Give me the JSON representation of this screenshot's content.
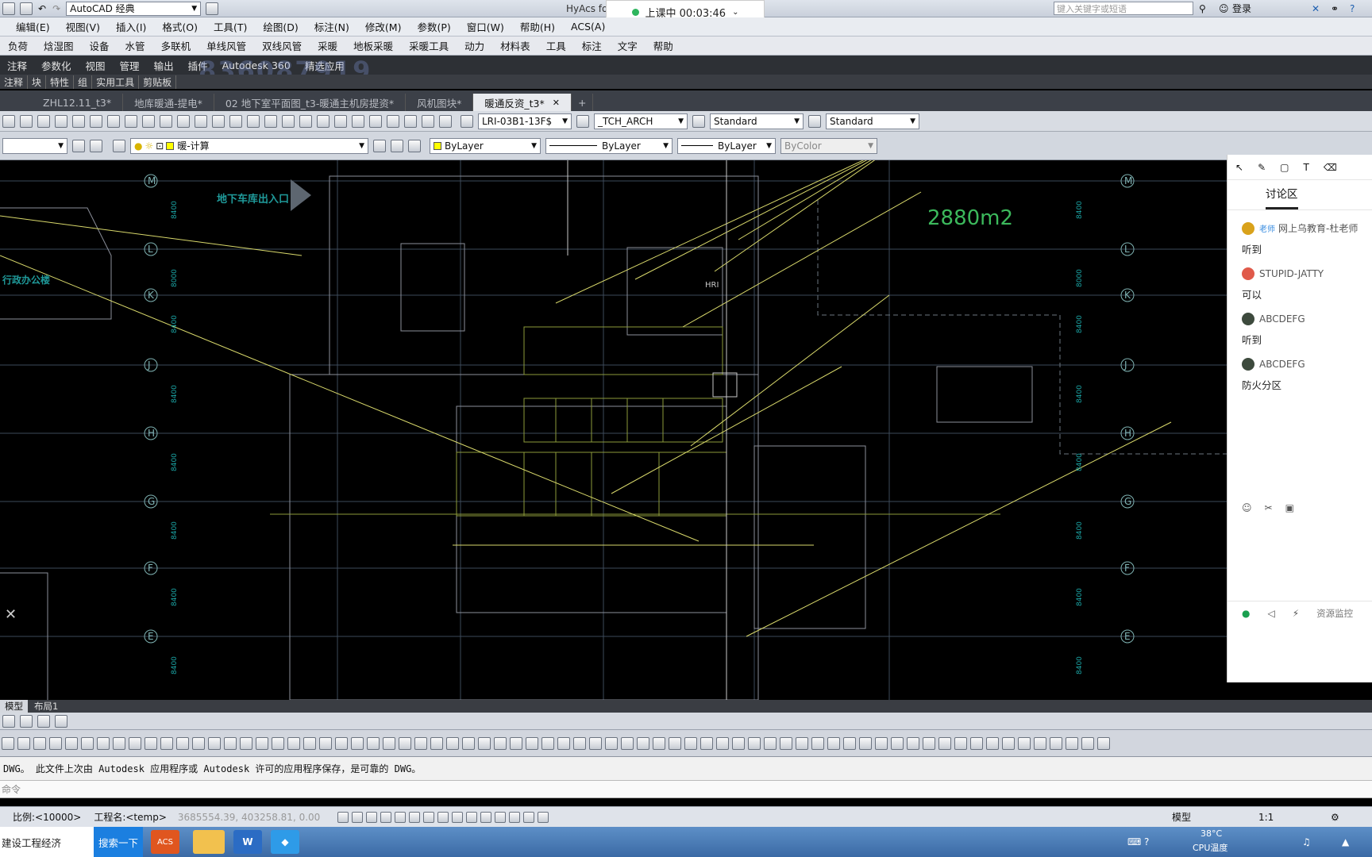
{
  "titlebar": {
    "workspace": "AutoCAD 经典",
    "app_title": "HyAcs fo",
    "search_placeholder": "键入关键字或短语",
    "login": "登录"
  },
  "class_status": {
    "label": "上课中 00:03:46"
  },
  "watermark": "836087919",
  "menu": [
    "编辑(E)",
    "视图(V)",
    "插入(I)",
    "格式(O)",
    "工具(T)",
    "绘图(D)",
    "标注(N)",
    "修改(M)",
    "参数(P)",
    "窗口(W)",
    "帮助(H)",
    "ACS(A)"
  ],
  "plugin_menu": [
    "负荷",
    "焓湿图",
    "设备",
    "水管",
    "多联机",
    "单线风管",
    "双线风管",
    "采暖",
    "地板采暖",
    "采暖工具",
    "动力",
    "材料表",
    "工具",
    "标注",
    "文字",
    "帮助"
  ],
  "ribbon_tabs": [
    "注释",
    "参数化",
    "视图",
    "管理",
    "输出",
    "插件",
    "Autodesk 360",
    "精选应用"
  ],
  "ribbon_panels": [
    "注释",
    "块",
    "特性",
    "组",
    "实用工具",
    "剪贴板"
  ],
  "doc_tabs": [
    {
      "label": "ZHL12.11_t3*",
      "active": false
    },
    {
      "label": "地库暖通-提电*",
      "active": false
    },
    {
      "label": "02 地下室平面图_t3-暖通主机房提资*",
      "active": false
    },
    {
      "label": "风机图块*",
      "active": false
    },
    {
      "label": "暖通反资_t3*",
      "active": true
    }
  ],
  "styles": {
    "text_style": "LRI-03B1-13F$",
    "dim_style": "_TCH_ARCH",
    "table_style": "Standard",
    "multileader_style": "Standard"
  },
  "layer": {
    "current": "暖-计算",
    "color": "ByLayer",
    "linetype": "ByLayer",
    "lineweight": "ByLayer",
    "plotstyle": "ByColor"
  },
  "drawing": {
    "area_label": "2880m2",
    "entrance_label": "地下车库出入口",
    "office_label": "行政办公楼",
    "grid_labels": [
      "M",
      "L",
      "K",
      "J",
      "H",
      "G",
      "F",
      "E"
    ],
    "dims": [
      "8400",
      "8000",
      "8400",
      "8400",
      "8400",
      "8400",
      "8400",
      "8400"
    ],
    "hri_label": "HRI"
  },
  "layout_tabs": [
    {
      "label": "模型",
      "active": true
    },
    {
      "label": "布局1",
      "active": false
    }
  ],
  "command": {
    "history": "DWG。   此文件上次由 Autodesk 应用程序或 Autodesk 许可的应用程序保存，是可靠的 DWG。",
    "prompt": "命令"
  },
  "status": {
    "scale": "比例:<10000>",
    "project": "工程名:<temp>",
    "coords": "3685554.39, 403258.81, 0.00",
    "model_label": "模型",
    "anno_scale": "1:1"
  },
  "chat": {
    "tab_label": "讨论区",
    "messages": [
      {
        "name": "网上乌教育-杜老师",
        "tag": "老师",
        "text": "听到",
        "color": "#d9a21b"
      },
      {
        "name": "STUPID-JATTY",
        "tag": "",
        "text": "可以",
        "color": "#e05a4a"
      },
      {
        "name": "ABCDEFG",
        "tag": "",
        "text": "听到",
        "color": "#3d4a3d"
      },
      {
        "name": "ABCDEFG",
        "tag": "",
        "text": "防火分区",
        "color": "#3d4a3d"
      }
    ],
    "resource_monitor": "资源监控"
  },
  "taskbar": {
    "start_app": "建设工程经济",
    "search_button": "搜索一下",
    "acs_label": "ACS",
    "temperature": "38°C",
    "cpu_label": "CPU温度"
  }
}
